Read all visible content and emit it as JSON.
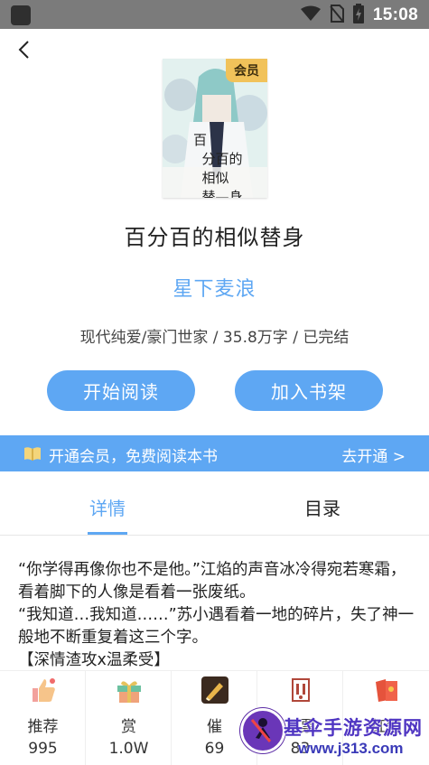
{
  "status_bar": {
    "time": "15:08",
    "icons": [
      "wifi-icon",
      "no-sim-icon",
      "battery-charging-icon"
    ]
  },
  "nav": {
    "back_icon": "chevron-left-icon"
  },
  "book": {
    "cover_badge": "会员",
    "cover_title": "百\n  分百的\n  相似\n  替—身",
    "title": "百分百的相似替身",
    "author": "星下麦浪",
    "meta": "现代纯爱/豪门世家 / 35.8万字 / 已完结"
  },
  "actions": {
    "start_reading": "开始阅读",
    "add_to_shelf": "加入书架"
  },
  "vip_banner": {
    "text": "开通会员，免费阅读本书",
    "link": "去开通 >"
  },
  "tabs": [
    {
      "label": "详情",
      "active": true
    },
    {
      "label": "目录",
      "active": false
    }
  ],
  "description": [
    "“你学得再像你也不是他。”江焰的声音冰冷得宛若寒霜，看着脚下的人像是看着一张废纸。",
    "“我知道…我知道……”苏小遇看着一地的碎片，失了神一般地不断重复着这三个字。",
    "【深情渣攻x温柔受】"
  ],
  "bottom_bar": [
    {
      "label": "推荐",
      "count": "995",
      "icon": "thumbs-up-icon"
    },
    {
      "label": "赏",
      "count": "1.0W",
      "icon": "gift-icon"
    },
    {
      "label": "催",
      "count": "69",
      "icon": "pen-icon"
    },
    {
      "label": "月票",
      "count": "83",
      "icon": "ticket-icon"
    },
    {
      "label": "红包",
      "count": "",
      "icon": "red-packet-icon"
    }
  ],
  "watermark": {
    "text": "基伞手游资源网",
    "url": "www.j313.com"
  },
  "colors": {
    "accent": "#5ea7f3",
    "status_bar": "#7b7b7b",
    "text": "#222222"
  }
}
